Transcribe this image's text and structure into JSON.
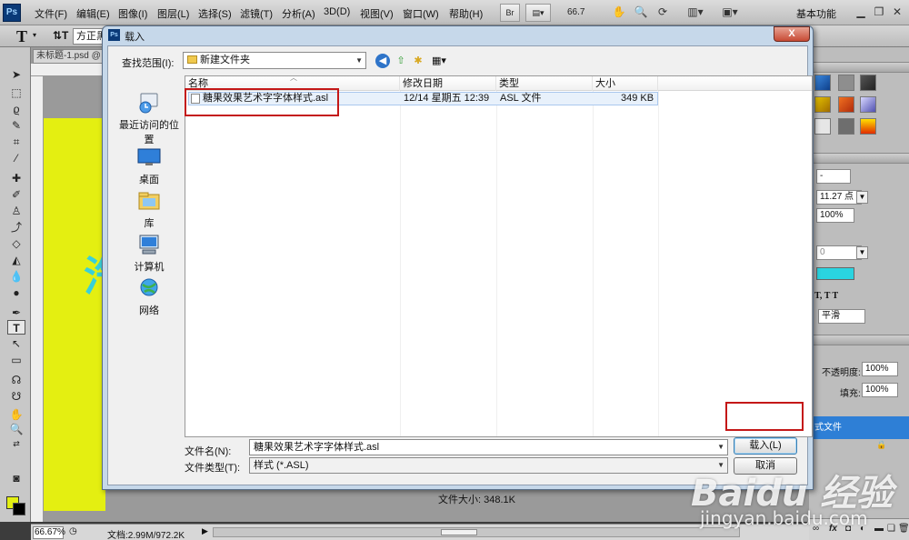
{
  "menubar": {
    "logo": "Ps",
    "items": [
      "文件(F)",
      "编辑(E)",
      "图像(I)",
      "图层(L)",
      "选择(S)",
      "滤镜(T)",
      "分析(A)",
      "3D(D)",
      "视图(V)",
      "窗口(W)",
      "帮助(H)"
    ],
    "br_label": "Br",
    "zoom": "66.7",
    "workspace": "基本功能"
  },
  "options": {
    "font_family": "方正黑"
  },
  "document": {
    "tab": "未标题-1.psd @ 6",
    "canvas_char": "汽"
  },
  "status": {
    "zoom": "66.67%",
    "doc_info": "文档:2.99M/972.2K"
  },
  "right_panel": {
    "size_field": "-",
    "font_size": "11.27 点",
    "scale": "100%",
    "tracking": "0",
    "text_style_icons": "T, T T",
    "antialias": "平滑",
    "opacity_label": "不透明度:",
    "opacity": "100%",
    "fill_label": "填充:",
    "fill": "100%",
    "layer_name": "式文件",
    "colors": {
      "swatch_cyan": "#2ad4e0",
      "layer_selected": "#2e7fd6"
    }
  },
  "dialog": {
    "title": "载入",
    "close_label": "X",
    "lookin_label": "查找范围(I):",
    "lookin_value": "新建文件夹",
    "places": [
      {
        "label": "最近访问的位置",
        "icon": "recent-places-icon"
      },
      {
        "label": "桌面",
        "icon": "desktop-icon"
      },
      {
        "label": "库",
        "icon": "libraries-icon"
      },
      {
        "label": "计算机",
        "icon": "computer-icon"
      },
      {
        "label": "网络",
        "icon": "network-icon"
      }
    ],
    "columns": [
      "名称",
      "修改日期",
      "类型",
      "大小"
    ],
    "files": [
      {
        "name": "糖果效果艺术字字体样式.asl",
        "date": "12/14 星期五 12:39",
        "type": "ASL 文件",
        "size": "349 KB"
      }
    ],
    "filename_label": "文件名(N):",
    "filename_value": "糖果效果艺术字字体样式.asl",
    "filetype_label": "文件类型(T):",
    "filetype_value": "样式 (*.ASL)",
    "load_label": "载入(L)",
    "cancel_label": "取消",
    "filesize": "文件大小: 348.1K"
  },
  "watermark": {
    "logo": "Baidu 经验",
    "url": "jingyan.baidu.com"
  }
}
